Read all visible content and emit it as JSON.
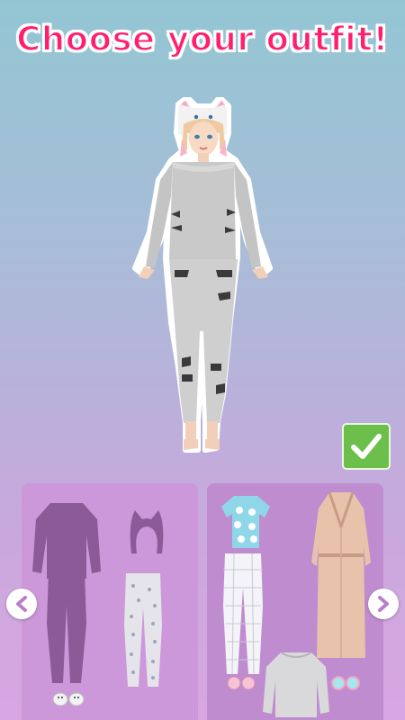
{
  "screen": {
    "title": "Choose your outfit!"
  },
  "colors": {
    "title_text": "#ff1f6e",
    "title_outline": "#ffffff",
    "confirm_button": "#6cbf4a",
    "panel_left": "#cd98d9",
    "panel_right": "#bf8cd0",
    "silhouette": "#8b5a97"
  },
  "character": {
    "outfit": "gray cat pajamas with cat-ear hood"
  },
  "outfit_options": [
    {
      "id": "option-1",
      "items": [
        "sweatshirt-silhouette",
        "cat-ear-headband-silhouette",
        "pants-silhouette",
        "cat-print-pajama-pants",
        "cat-slippers"
      ]
    },
    {
      "id": "option-2",
      "items": [
        "cat-print-tshirt",
        "pink-satin-robe",
        "white-plaid-pants",
        "gray-sweatshirt",
        "pink-slippers",
        "blue-slippers"
      ]
    }
  ],
  "icons": {
    "confirm": "checkmark-icon",
    "prev": "chevron-left-icon",
    "next": "chevron-right-icon"
  }
}
